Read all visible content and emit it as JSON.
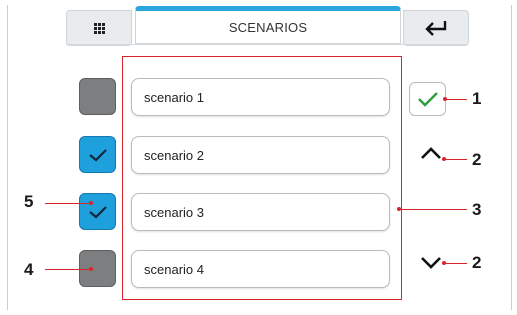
{
  "header": {
    "title": "SCENARIOS",
    "menu_icon": "grid-icon",
    "back_icon": "return-icon"
  },
  "scenarios": [
    {
      "label": "scenario 1",
      "checked": false
    },
    {
      "label": "scenario 2",
      "checked": true
    },
    {
      "label": "scenario 3",
      "checked": true
    },
    {
      "label": "scenario 4",
      "checked": false
    }
  ],
  "controls": {
    "confirm_icon": "check-icon",
    "scroll_up_icon": "chevron-up-icon",
    "scroll_down_icon": "chevron-down-icon"
  },
  "callouts": {
    "c1": "1",
    "c2_top": "2",
    "c3": "3",
    "c2_bottom": "2",
    "c4": "4",
    "c5": "5"
  },
  "colors": {
    "accent": "#2aa5dd",
    "checked": "#1ea0dd",
    "unchecked": "#7d7e80",
    "annotation": "#d9252e",
    "confirm": "#2e9e3e"
  }
}
